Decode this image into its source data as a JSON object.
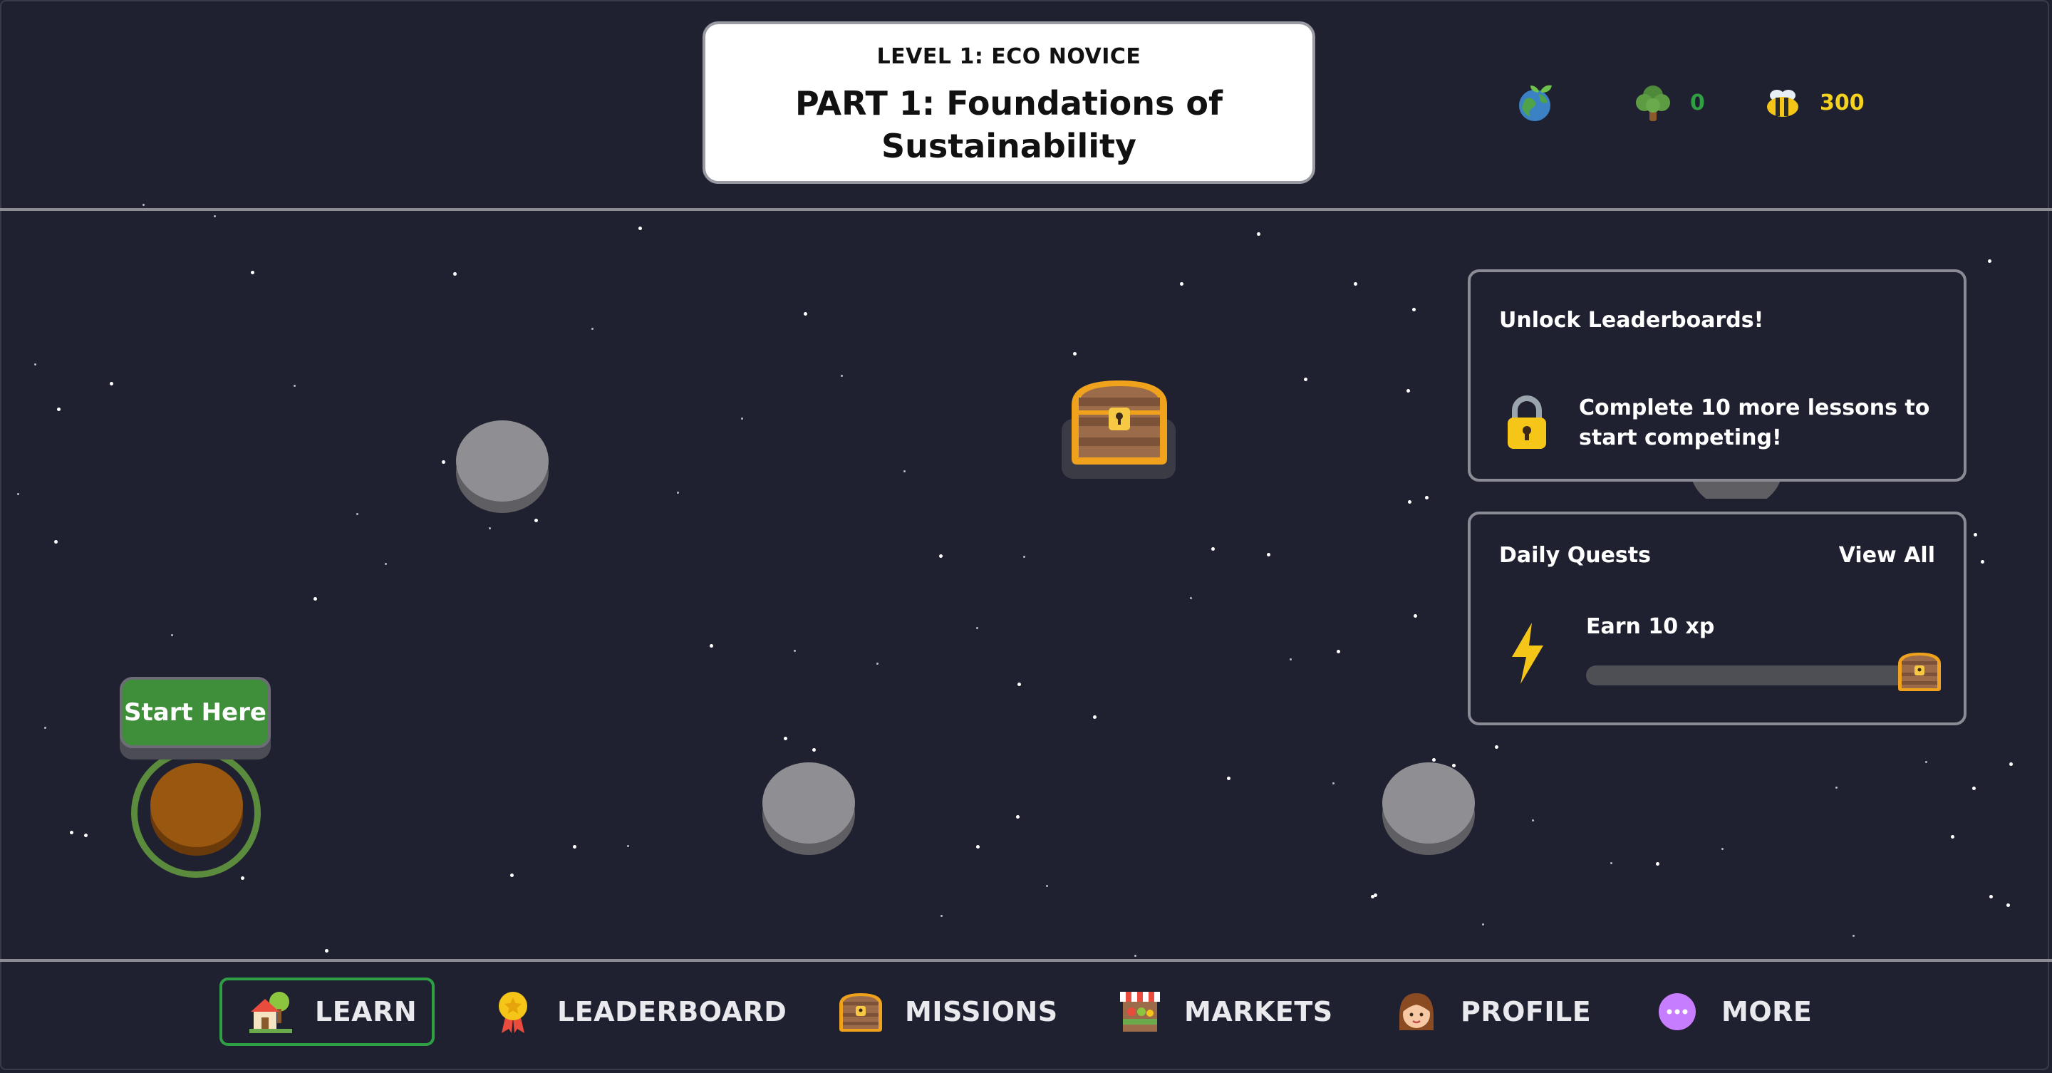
{
  "header": {
    "level_label": "LEVEL 1: ECO NOVICE",
    "part_title": "PART 1: Foundations of Sustainability"
  },
  "stats": {
    "globe_icon": "earth-plant-icon",
    "trees": {
      "icon": "tree-icon",
      "value": "0",
      "color": "#2ea043"
    },
    "bees": {
      "icon": "bee-icon",
      "value": "300",
      "color": "#f5d21d"
    }
  },
  "map": {
    "start_label": "Start Here",
    "start_color": "#3e8e3a",
    "locked_node_color": "#8f8f93"
  },
  "leaderboard_panel": {
    "title": "Unlock Leaderboards!",
    "message": "Complete 10 more lessons to start competing!",
    "icon": "lock-icon"
  },
  "quests_panel": {
    "title": "Daily Quests",
    "view_all": "View All",
    "quest_label": "Earn 10 xp",
    "quest_progress": 0,
    "icon": "lightning-icon",
    "reward_icon": "treasure-chest-icon"
  },
  "nav": {
    "items": [
      {
        "label": "LEARN",
        "icon": "house-tree-icon",
        "active": true
      },
      {
        "label": "LEADERBOARD",
        "icon": "medal-icon",
        "active": false
      },
      {
        "label": "MISSIONS",
        "icon": "treasure-chest-icon",
        "active": false
      },
      {
        "label": "MARKETS",
        "icon": "market-stall-icon",
        "active": false
      },
      {
        "label": "PROFILE",
        "icon": "girl-face-icon",
        "active": false
      },
      {
        "label": "MORE",
        "icon": "more-dots-icon",
        "active": false
      }
    ],
    "active_color": "#2ea043"
  }
}
